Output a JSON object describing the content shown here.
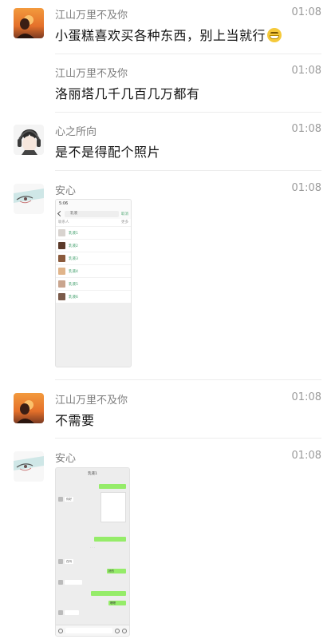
{
  "messages": [
    {
      "name": "江山万里不及你",
      "time": "01:08",
      "text": "小蛋糕喜欢买各种东西，别上当就行"
    },
    {
      "name": "江山万里不及你",
      "time": "01:08",
      "text": "洛丽塔几千几百几万都有"
    },
    {
      "name": "心之所向",
      "time": "01:08",
      "text": "是不是得配个照片"
    },
    {
      "name": "安心",
      "time": "01:08"
    },
    {
      "name": "江山万里不及你",
      "time": "01:08",
      "text": "不需要"
    },
    {
      "name": "安心",
      "time": "01:08"
    }
  ],
  "shot1": {
    "status_time": "5:06",
    "search_text": "乳液",
    "cancel": "取消",
    "head_left": "联系人",
    "head_right": "更多",
    "contacts": [
      "乳液1",
      "乳液2",
      "乳液3",
      "乳液4",
      "乳液5",
      "乳液6"
    ],
    "avatar_colors": [
      "#d8d3cf",
      "#5b3a2a",
      "#8a5a3c",
      "#e0b48a",
      "#c9a58e",
      "#7a5a4a"
    ]
  },
  "shot2": {
    "title": "乳液1",
    "msgs": [
      "你好",
      "在吗",
      "好的",
      "嗯嗯"
    ]
  },
  "colors": {
    "name": "#7d7d7d",
    "time": "#9a9a9a",
    "bubble_green": "#95ec69",
    "contact_green": "#3a9b66"
  }
}
